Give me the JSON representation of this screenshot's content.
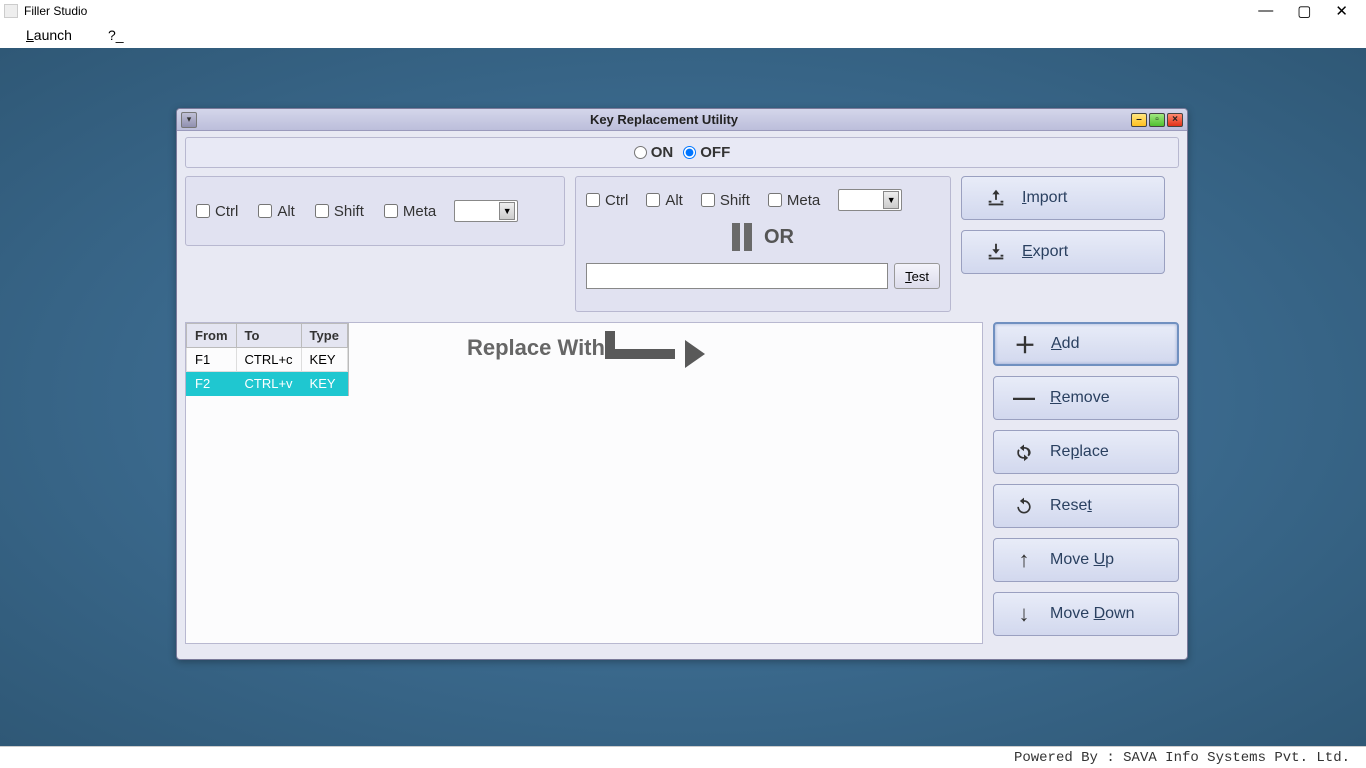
{
  "titlebar": {
    "title": "Filler Studio"
  },
  "menubar": {
    "launch": "Launch",
    "help": "?_"
  },
  "inner": {
    "title": "Key Replacement Utility"
  },
  "toggle": {
    "on": "ON",
    "off": "OFF"
  },
  "modifiers": {
    "ctrl": "Ctrl",
    "alt": "Alt",
    "shift": "Shift",
    "meta": "Meta"
  },
  "labels": {
    "replace_with": "Replace With",
    "or": "OR"
  },
  "buttons": {
    "import": "Import",
    "export": "Export",
    "add": "Add",
    "remove": "Remove",
    "replace": "Replace",
    "reset": "Reset",
    "moveup": "Move Up",
    "movedown": "Move Down",
    "test": "Test"
  },
  "table": {
    "headers": {
      "from": "From",
      "to": "To",
      "type": "Type"
    },
    "rows": [
      {
        "from": "F1",
        "to": "CTRL+c",
        "type": "KEY",
        "selected": false
      },
      {
        "from": "F2",
        "to": "CTRL+v",
        "type": "KEY",
        "selected": true
      }
    ]
  },
  "footer": {
    "text": "Powered By : SAVA Info Systems Pvt. Ltd."
  }
}
